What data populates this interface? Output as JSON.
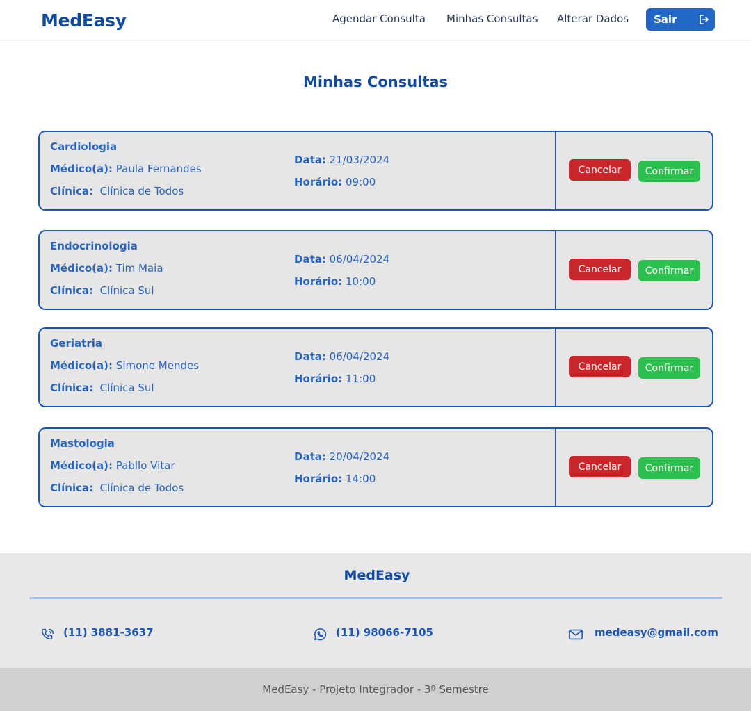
{
  "header": {
    "logo": "MedEasy",
    "nav": [
      "Agendar Consulta",
      "Minhas Consultas",
      "Alterar Dados"
    ],
    "logout_label": "Sair"
  },
  "page_title": "Minhas Consultas",
  "labels": {
    "medico": "Médico(a):",
    "clinica": "Clínica:",
    "data": "Data:",
    "horario": "Horário:",
    "cancel": "Cancelar",
    "confirm": "Confirmar"
  },
  "appointments": [
    {
      "specialty": "Cardiologia",
      "doctor": "Paula Fernandes",
      "clinic": "Clínica de Todos",
      "date": "21/03/2024",
      "time": "09:00"
    },
    {
      "specialty": "Endocrinologia",
      "doctor": "Tim Maia",
      "clinic": "Clínica Sul",
      "date": "06/04/2024",
      "time": "10:00"
    },
    {
      "specialty": "Geriatria",
      "doctor": "Simone Mendes",
      "clinic": "Clínica Sul",
      "date": "06/04/2024",
      "time": "11:00"
    },
    {
      "specialty": "Mastologia",
      "doctor": "Pabllo Vitar",
      "clinic": "Clínica de Todos",
      "date": "20/04/2024",
      "time": "14:00"
    }
  ],
  "footer": {
    "logo": "MedEasy",
    "phone": "(11) 3881-3637",
    "whatsapp": "(11) 98066-7105",
    "email": "medeasy@gmail.com",
    "credits": "MedEasy - Projeto Integrador - 3º Semestre"
  },
  "icons": {
    "logout": "logout-icon",
    "phone": "phone-icon",
    "whatsapp": "whatsapp-icon",
    "email": "mail-icon"
  },
  "colors": {
    "brand": "#124a9c",
    "accent": "#2367c4",
    "cancel": "#c8262b",
    "confirm": "#2ec04e"
  }
}
